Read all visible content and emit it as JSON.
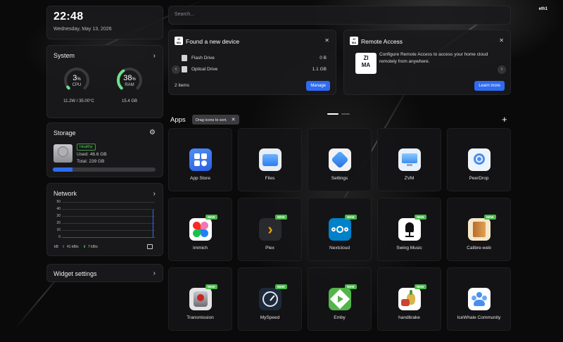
{
  "clock": {
    "time": "22:48",
    "date": "Wednesday, May 13, 2026"
  },
  "system": {
    "title": "System",
    "cpu": {
      "percent": "3",
      "unit": "%",
      "label": "CPU",
      "detail": "11.2W / 35.00°C",
      "fraction": 0.03
    },
    "ram": {
      "percent": "38",
      "unit": "%",
      "label": "RAM",
      "detail": "15.4 GB",
      "fraction": 0.38
    }
  },
  "storage": {
    "title": "Storage",
    "status": "Healthy",
    "used": "Used: 46.6 GB",
    "total": "Total: 239 GB",
    "used_fraction": 0.195
  },
  "network": {
    "title": "Network",
    "interface": "eth1",
    "yticks": [
      "50",
      "40",
      "30",
      "20",
      "10",
      "0"
    ],
    "unit": "kB",
    "upload": "41 kB/s",
    "download": "7 kB/s"
  },
  "widget_settings": {
    "label": "Widget settings"
  },
  "search": {
    "placeholder": "Search..."
  },
  "device_card": {
    "title": "Found a new device",
    "items": [
      {
        "name": "Flash Drive",
        "size": "0 B"
      },
      {
        "name": "Optical Drive",
        "size": "1.1 GB"
      }
    ],
    "count": "2 items",
    "button": "Manage"
  },
  "remote_card": {
    "title": "Remote Access",
    "description": "Configure Remote Access to access your home cloud remotely from anywhere.",
    "button": "Learn more"
  },
  "apps_section": {
    "label": "Apps",
    "tooltip": "Drag icons to sort."
  },
  "apps": [
    {
      "name": "App Store",
      "new": false,
      "icon": "app-store-icon"
    },
    {
      "name": "Files",
      "new": false,
      "icon": "files-icon"
    },
    {
      "name": "Settings",
      "new": false,
      "icon": "settings-icon"
    },
    {
      "name": "ZVM",
      "new": false,
      "icon": "zvm-icon"
    },
    {
      "name": "PeerDrop",
      "new": false,
      "icon": "peerdrop-icon"
    },
    {
      "name": "Immich",
      "new": true,
      "icon": "immich-icon"
    },
    {
      "name": "Plex",
      "new": true,
      "icon": "plex-icon"
    },
    {
      "name": "Nextcloud",
      "new": true,
      "icon": "nextcloud-icon"
    },
    {
      "name": "Swing Music",
      "new": true,
      "icon": "swing-music-icon"
    },
    {
      "name": "Calibre-web",
      "new": true,
      "icon": "calibre-web-icon"
    },
    {
      "name": "Transmission",
      "new": true,
      "icon": "transmission-icon"
    },
    {
      "name": "MySpeed",
      "new": true,
      "icon": "myspeed-icon"
    },
    {
      "name": "Emby",
      "new": true,
      "icon": "emby-icon"
    },
    {
      "name": "handbrake",
      "new": true,
      "icon": "handbrake-icon"
    },
    {
      "name": "IceWhale Community",
      "new": false,
      "icon": "icewhale-community-icon"
    }
  ],
  "badge_new": "NEW",
  "colors": {
    "accent": "#2f6bf0",
    "healthy": "#55d05a",
    "gauge": "#6fe08a"
  }
}
